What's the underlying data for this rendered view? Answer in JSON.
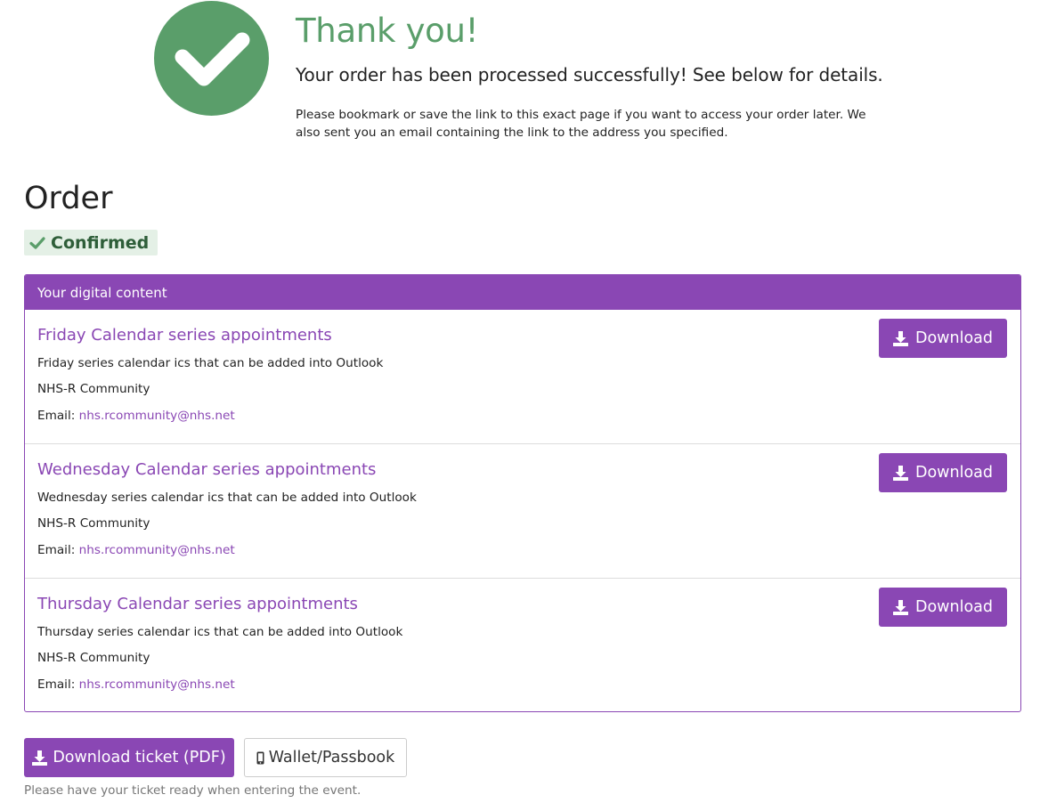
{
  "thanks": {
    "icon": "check-circle-icon",
    "title": "Thank you!",
    "subtitle": "Your order has been processed successfully! See below for details.",
    "note": "Please bookmark or save the link to this exact page if you want to access your order later. We also sent you an email containing the link to the address you specified."
  },
  "order": {
    "title": "Order",
    "status": "Confirmed",
    "status_icon": "check-icon"
  },
  "digital_content": {
    "header": "Your digital content",
    "items": [
      {
        "title": "Friday Calendar series appointments",
        "description": "Friday series calendar ics that can be added into Outlook",
        "organizer": "NHS-R Community",
        "email_label": "Email:",
        "email": "nhs.rcommunity@nhs.net",
        "button_label": "Download",
        "button_icon": "download-icon"
      },
      {
        "title": "Wednesday Calendar series appointments",
        "description": "Wednesday series calendar ics that can be added into Outlook",
        "organizer": "NHS-R Community",
        "email_label": "Email:",
        "email": "nhs.rcommunity@nhs.net",
        "button_label": "Download",
        "button_icon": "download-icon"
      },
      {
        "title": "Thursday Calendar series appointments",
        "description": "Thursday series calendar ics that can be added into Outlook",
        "organizer": "NHS-R Community",
        "email_label": "Email:",
        "email": "nhs.rcommunity@nhs.net",
        "button_label": "Download",
        "button_icon": "download-icon"
      }
    ]
  },
  "actions": {
    "ticket_label": "Download ticket (PDF)",
    "wallet_label": "Wallet/Passbook",
    "hint": "Please have your ticket ready when entering the event."
  },
  "colors": {
    "accent": "#8a47b4",
    "success": "#5a9e6a",
    "badge_bg": "#e4f0e6",
    "badge_text": "#2e5e39"
  }
}
